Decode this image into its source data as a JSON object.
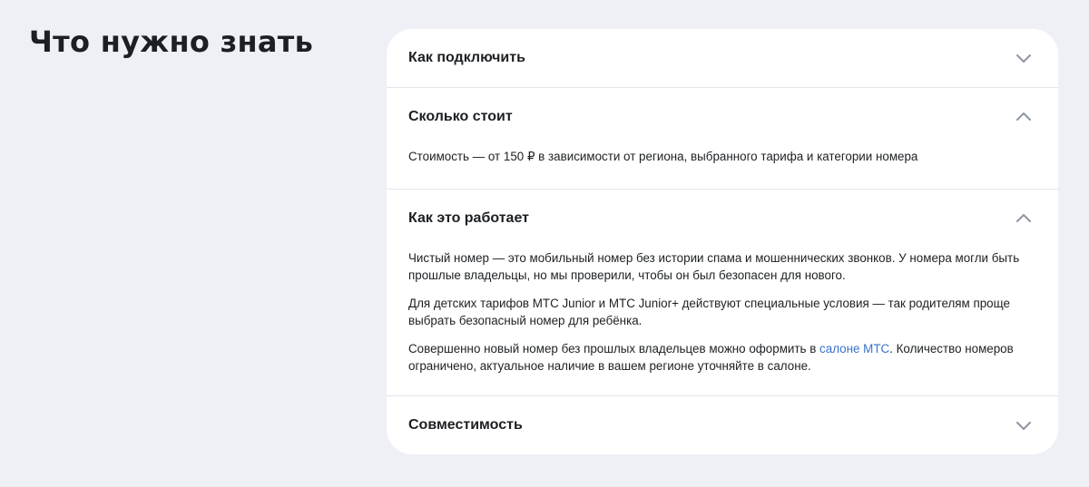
{
  "page": {
    "title": "Что нужно знать"
  },
  "faq": {
    "items": [
      {
        "question": "Как подключить",
        "expanded": false,
        "icon": "chevron-down-icon"
      },
      {
        "question": "Сколько стоит",
        "expanded": true,
        "icon": "chevron-up-icon",
        "answer": "Стоимость — от 150 ₽ в зависимости от региона, выбранного тарифа и категории номера"
      },
      {
        "question": "Как это работает",
        "expanded": true,
        "icon": "chevron-up-icon",
        "paragraph1": "Чистый номер — это мобильный номер без истории спама и мошеннических звонков. У номера могли быть прошлые владельцы, но мы проверили, чтобы он был безопасен для нового.",
        "paragraph2": "Для детских тарифов МТС Junior и МТС Junior+ действуют специальные условия — так родителям проще выбрать безопасный номер для ребёнка.",
        "paragraph3_before": "Совершенно новый номер без прошлых владельцев можно оформить в ",
        "paragraph3_link": "салоне МТС",
        "paragraph3_after": ". Количество номеров ограничено, актуальное наличие в вашем регионе уточняйте в салоне."
      },
      {
        "question": "Совместимость",
        "expanded": false,
        "icon": "chevron-down-icon"
      }
    ]
  },
  "colors": {
    "background": "#eef0f5",
    "card": "#ffffff",
    "text": "#1d2023",
    "link": "#3873c9",
    "divider": "#e2e5eb",
    "chevron": "#8d969f"
  }
}
